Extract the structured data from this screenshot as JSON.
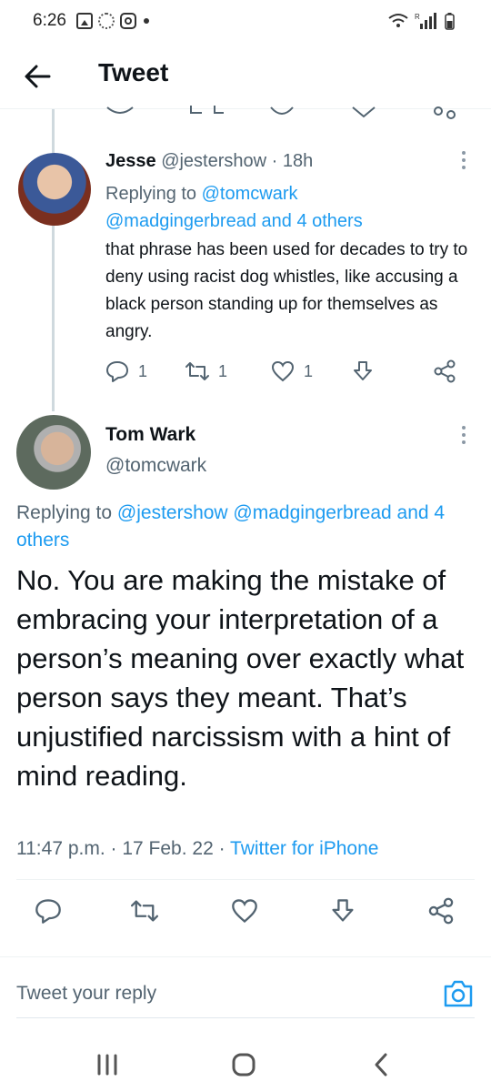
{
  "status_bar": {
    "time": "6:26",
    "icons": [
      "image-icon",
      "sync-icon",
      "instagram-icon",
      "dot-icon"
    ],
    "right_icons": [
      "wifi-icon",
      "signal-icon",
      "battery-icon"
    ],
    "network_label": "R"
  },
  "header": {
    "back_icon": "arrow-left-icon",
    "title": "Tweet"
  },
  "reply_tweet": {
    "display_name": "Jesse",
    "handle": "@jestershow",
    "separator": " · ",
    "time_ago": "18h",
    "replying_prefix": "Replying to ",
    "replying_to_first": "@tomcwark",
    "replying_to_second": "@madgingerbread and 4 others",
    "text": "that phrase has been used for decades to try to deny using racist dog whistles, like accusing a black person standing up for themselves as angry.",
    "actions": {
      "reply_count": "1",
      "retweet_count": "1",
      "like_count": "1"
    }
  },
  "main_tweet": {
    "display_name": "Tom Wark",
    "handle": "@tomcwark",
    "replying_prefix": "Replying to ",
    "replying_to": "@jestershow @madgingerbread and 4 others",
    "text": "No. You are making the mistake of embracing your interpretation of a person’s meaning over exactly what person says they meant. That’s unjustified narcissism with a hint of mind reading.",
    "time": "11:47 p.m.",
    "date": "17 Feb. 22",
    "meta_separator": " · ",
    "source": "Twitter for iPhone"
  },
  "reply_bar": {
    "placeholder": "Tweet your reply",
    "camera_icon": "camera-icon"
  },
  "nav_bar": {
    "icons": [
      "recent-apps-icon",
      "home-icon",
      "back-icon"
    ]
  },
  "colors": {
    "accent": "#1d9bf0",
    "muted_text": "#536471",
    "primary_text": "#0f1419",
    "thread_line": "#cfd9de"
  }
}
